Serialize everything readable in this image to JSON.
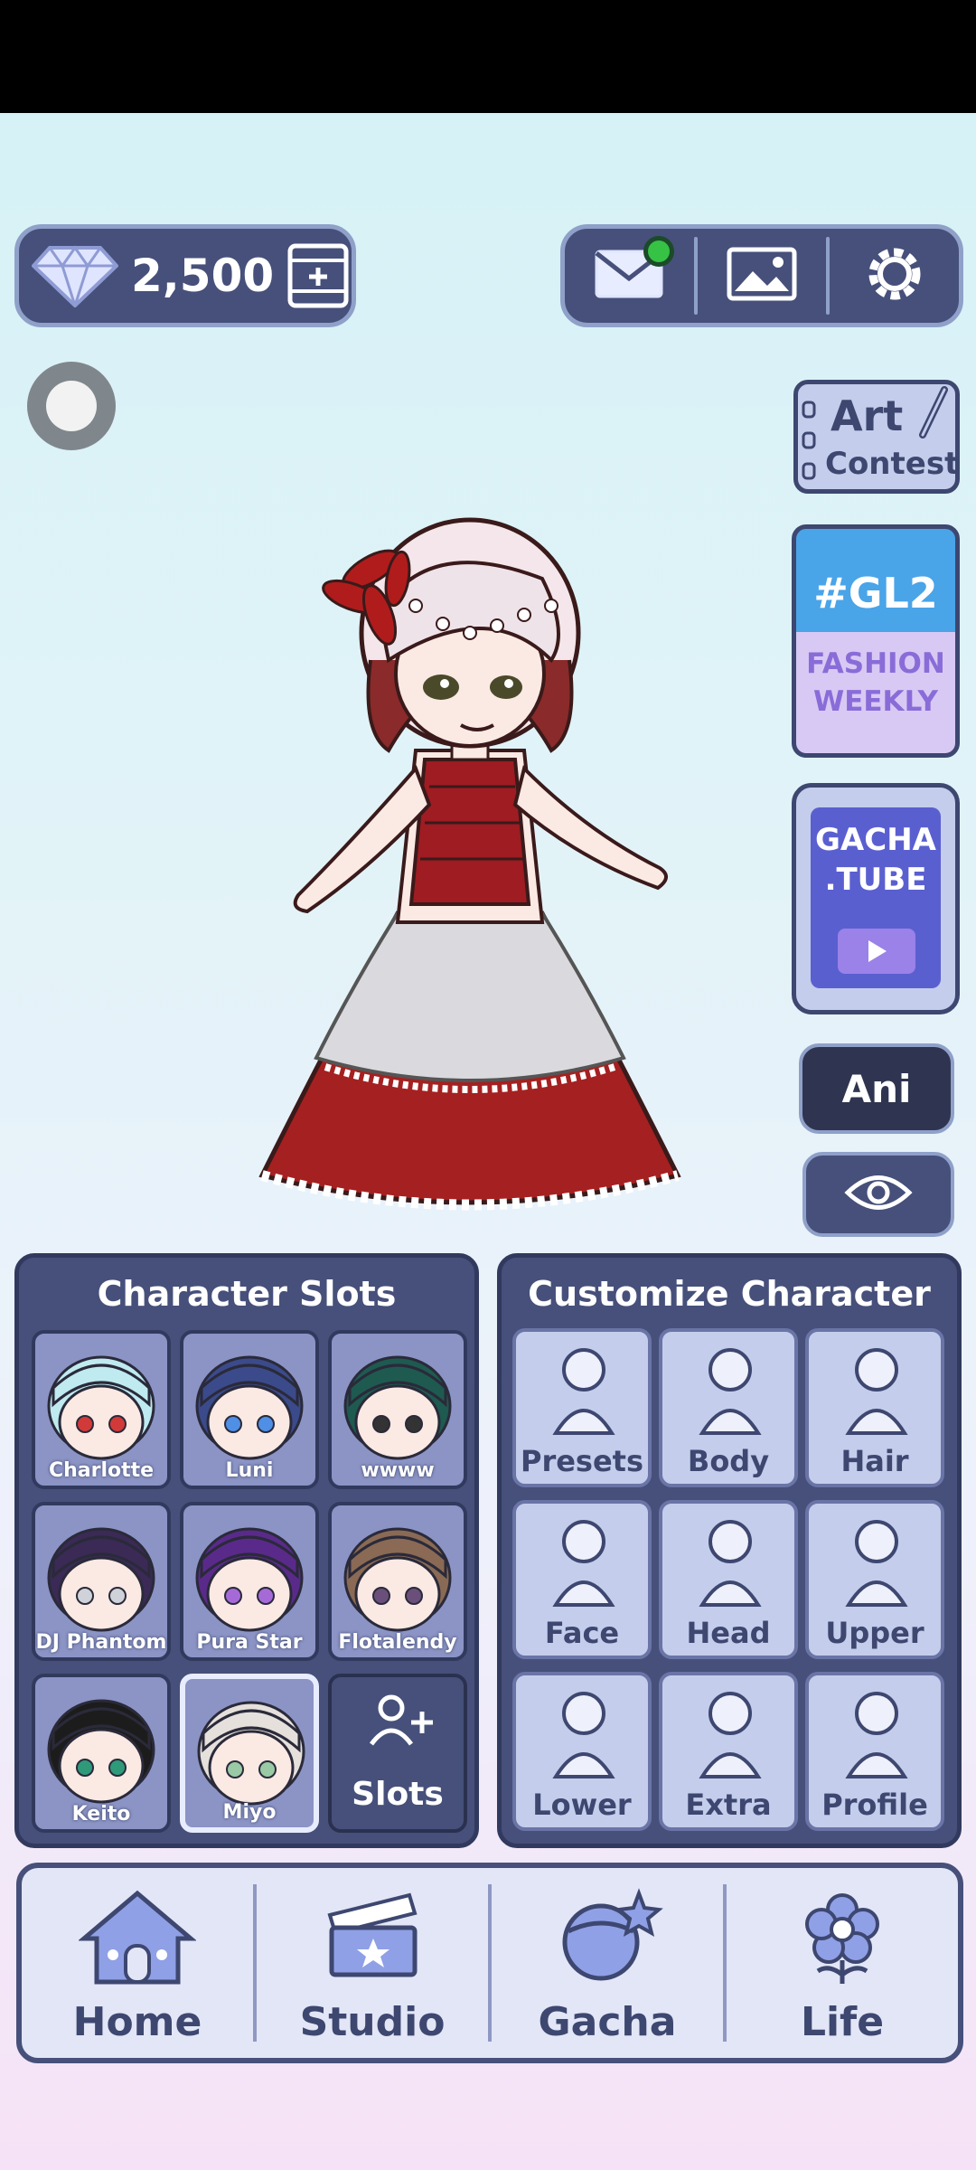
{
  "top_bar": {
    "gems": "2,500",
    "icons": [
      "diamond-icon",
      "add-gems-icon",
      "mail-icon",
      "gallery-icon",
      "settings-icon"
    ]
  },
  "promos": {
    "art_contest_line1": "Art",
    "art_contest_line2": "Contest",
    "gl2_tag": "#GL2",
    "gl2_line1": "FASHION",
    "gl2_line2": "WEEKLY",
    "gachatube_line1": "GACHA",
    "gachatube_line2": ".TUBE"
  },
  "side_buttons": {
    "ani_label": "Ani"
  },
  "character_slots": {
    "title": "Character Slots",
    "slots": [
      {
        "name": "Charlotte",
        "hair": "#bfeaf0",
        "eyes": "#d23a3a"
      },
      {
        "name": "Luni",
        "hair": "#3b4a8a",
        "eyes": "#4f8fe6"
      },
      {
        "name": "wwww",
        "hair": "#1e5a50",
        "eyes": "#333333"
      },
      {
        "name": "DJ Phantom",
        "hair": "#3a2a55",
        "eyes": "#cfd2d8"
      },
      {
        "name": "Pura Star",
        "hair": "#5a2a8a",
        "eyes": "#a66ad8"
      },
      {
        "name": "Flotalendy",
        "hair": "#8a6a55",
        "eyes": "#6a4f7a"
      },
      {
        "name": "Keito",
        "hair": "#1c1c1c",
        "eyes": "#2e9a7a"
      },
      {
        "name": "Miyo",
        "hair": "#e6e0dc",
        "eyes": "#9ac9a6"
      }
    ],
    "add_label": "Slots"
  },
  "customize": {
    "title": "Customize Character",
    "items": [
      "Presets",
      "Body",
      "Hair",
      "Face",
      "Head",
      "Upper",
      "Lower",
      "Extra",
      "Profile"
    ]
  },
  "nav": {
    "items": [
      "Home",
      "Studio",
      "Gacha",
      "Life"
    ]
  }
}
